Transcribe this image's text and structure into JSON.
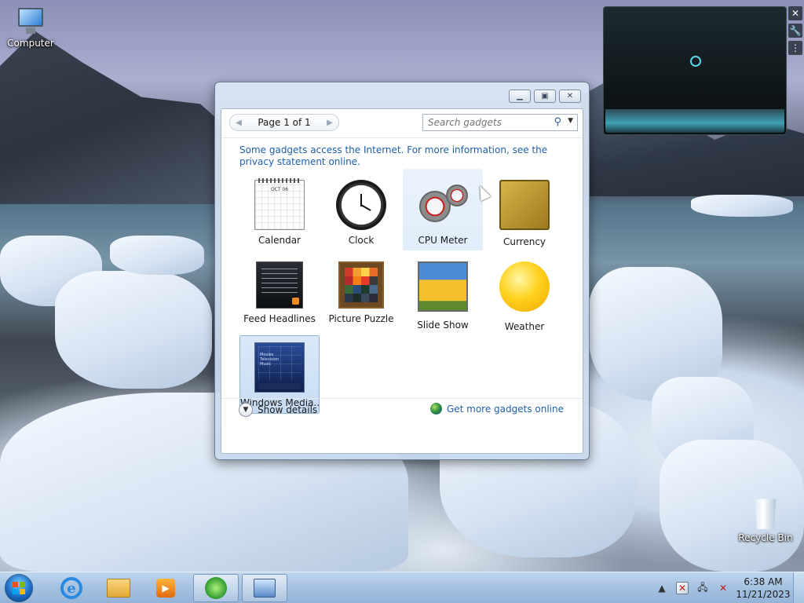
{
  "desktop": {
    "icons": [
      {
        "label": "Computer",
        "icon": "computer-icon"
      },
      {
        "label": "Recycle Bin",
        "icon": "recycle-bin-icon"
      }
    ]
  },
  "gadget_window": {
    "pager": {
      "label": "Page 1 of 1"
    },
    "search": {
      "placeholder": "Search gadgets"
    },
    "privacy_notice": "Some gadgets access the Internet.  For more information, see the privacy statement online.",
    "gadgets": [
      {
        "label": "Calendar",
        "icon": "calendar-gadget-icon",
        "calendar_month": "OCT 06"
      },
      {
        "label": "Clock",
        "icon": "clock-gadget-icon"
      },
      {
        "label": "CPU Meter",
        "icon": "cpu-meter-gadget-icon",
        "state": "hover"
      },
      {
        "label": "Currency",
        "icon": "currency-gadget-icon"
      },
      {
        "label": "Feed Headlines",
        "icon": "feed-headlines-gadget-icon"
      },
      {
        "label": "Picture Puzzle",
        "icon": "picture-puzzle-gadget-icon"
      },
      {
        "label": "Slide Show",
        "icon": "slide-show-gadget-icon"
      },
      {
        "label": "Weather",
        "icon": "weather-gadget-icon"
      },
      {
        "label": "Windows Media...",
        "icon": "windows-media-center-gadget-icon",
        "state": "selected",
        "thumb_lines": [
          "Movies",
          "Television",
          "Music"
        ]
      }
    ],
    "show_details": "Show details",
    "get_more": "Get more gadgets online"
  },
  "taskbar": {
    "pinned": [
      {
        "icon": "start-orb-icon"
      },
      {
        "icon": "internet-explorer-icon"
      },
      {
        "icon": "file-explorer-icon"
      },
      {
        "icon": "media-player-icon"
      },
      {
        "icon": "windows-logo-app-icon"
      },
      {
        "icon": "gadgets-app-icon"
      }
    ],
    "tray": {
      "time": "6:38 AM",
      "date": "11/21/2023",
      "icons": [
        "show-hidden-icons-icon",
        "action-center-icon",
        "network-icon",
        "volume-muted-icon"
      ]
    }
  },
  "colors": {
    "link": "#1e5fa8",
    "taskbar": "#a7c3e2",
    "selection": "#c6dcf4"
  }
}
